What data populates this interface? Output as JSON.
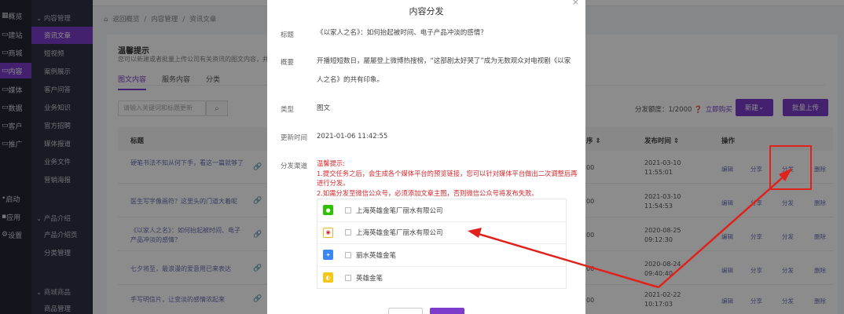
{
  "rail": {
    "items": [
      {
        "label": "概览",
        "icon": "grid-icon",
        "active": false
      },
      {
        "label": "建站",
        "icon": "site-icon",
        "active": false
      },
      {
        "label": "商城",
        "icon": "shop-icon",
        "active": false
      },
      {
        "label": "内容",
        "icon": "content-icon",
        "active": true
      },
      {
        "label": "媒体",
        "icon": "media-icon",
        "active": false
      },
      {
        "label": "数据",
        "icon": "data-icon",
        "active": false
      },
      {
        "label": "客户",
        "icon": "user-icon",
        "active": false
      },
      {
        "label": "推广",
        "icon": "promo-icon",
        "active": false
      },
      {
        "label": "启动",
        "icon": "launch-icon",
        "active": false
      },
      {
        "label": "应用",
        "icon": "app-icon",
        "active": false
      },
      {
        "label": "设置",
        "icon": "gear-icon",
        "active": false
      }
    ]
  },
  "subnav": {
    "group1": "内容管理",
    "items1": [
      "资讯文章",
      "短视频",
      "案例展示",
      "客户问答",
      "业务知识",
      "官方招聘",
      "媒体报道",
      "业务文件",
      "营销海报"
    ],
    "group2": "产品介绍",
    "items2": [
      "产品介绍页",
      "分类管理"
    ],
    "group3": "商城商品",
    "items3": [
      "商品管理"
    ]
  },
  "breadcrumb": {
    "back": "返回概览",
    "sep": "/",
    "level1": "内容管理",
    "level2": "资讯文章"
  },
  "notice": {
    "title": "温馨提示",
    "text": "您可以新建或者批量上传公司有关资讯的图文内容，并"
  },
  "tabs": [
    "图文内容",
    "服务内容",
    "分类"
  ],
  "search": {
    "placeholder": "请输入关键词和标题更新"
  },
  "quota": {
    "label": "分发额度：1/2000",
    "buy": "立即购买"
  },
  "buttons": {
    "new": "新建",
    "upload": "批量上传"
  },
  "table": {
    "headers": {
      "title": "标题",
      "order": "序",
      "publish": "发布时间",
      "ops": "操作"
    },
    "rows": [
      {
        "title": "硬笔书法不知从何下手，看这一篇就够了",
        "num": "00",
        "date": "2021-03-10 11:55:01"
      },
      {
        "title": "医生写字像画符？这里头的门道大着呢",
        "num": "00",
        "date": "2021-03-10 11:54:53"
      },
      {
        "title": "《以家人之名》：如何抬起被时间、电子产品冲淡的感情？",
        "num": "00",
        "date": "2020-08-25 09:12:30"
      },
      {
        "title": "七夕将至，最浪漫的爱意用已来表达",
        "num": "00",
        "date": "2020-08-24 09:40:40"
      },
      {
        "title": "手写明信片，让变淡的感情浓起来",
        "num": "00",
        "date": "2021-02-22 10:17:03"
      }
    ],
    "actions": [
      "编辑",
      "分享",
      "分发",
      "删除"
    ]
  },
  "modal": {
    "title": "内容分发",
    "close": "×",
    "fields": {
      "title_label": "标题",
      "title_value": "《以家人之名》：如何抬起被时间、电子产品冲淡的感情？",
      "summary_label": "概要",
      "summary_value": "开播短短数日，屡屡登上微博热搜榜，“这部剧太好哭了”成为无数观众对电视剧《以家人之名》的共有印象。",
      "type_label": "类型",
      "type_value": "图文",
      "updated_label": "更新时间",
      "updated_value": "2021-01-06 11:42:55",
      "channel_label": "分发渠道"
    },
    "warning": {
      "title": "温馨提示:",
      "line1": "1.提交任务之后，会生成各个媒体平台的预览链接，您可以针对媒体平台做出二次调整后再进行分发。",
      "line2": "2.如需分发至微信公众号，必须添加文章主图，否则微信公众号将发布失败。"
    },
    "channels": [
      {
        "name": "上海英雄金笔厂丽水有限公司",
        "icon": "wechat-icon",
        "color": "#2dc100",
        "checked": false
      },
      {
        "name": "上海英雄金笔厂丽水有限公司",
        "icon": "weibo-icon",
        "color": "#f4b12a",
        "checked": false
      },
      {
        "name": "丽水英雄金笔",
        "icon": "baidu-icon",
        "color": "#3b87f5",
        "checked": false
      },
      {
        "name": "英雄金笔",
        "icon": "toutiao-icon",
        "color": "#f5c518",
        "checked": false
      }
    ]
  },
  "colors": {
    "accent": "#7d3cc9",
    "highlight": "#e0221d",
    "link": "#6a6fb5"
  }
}
